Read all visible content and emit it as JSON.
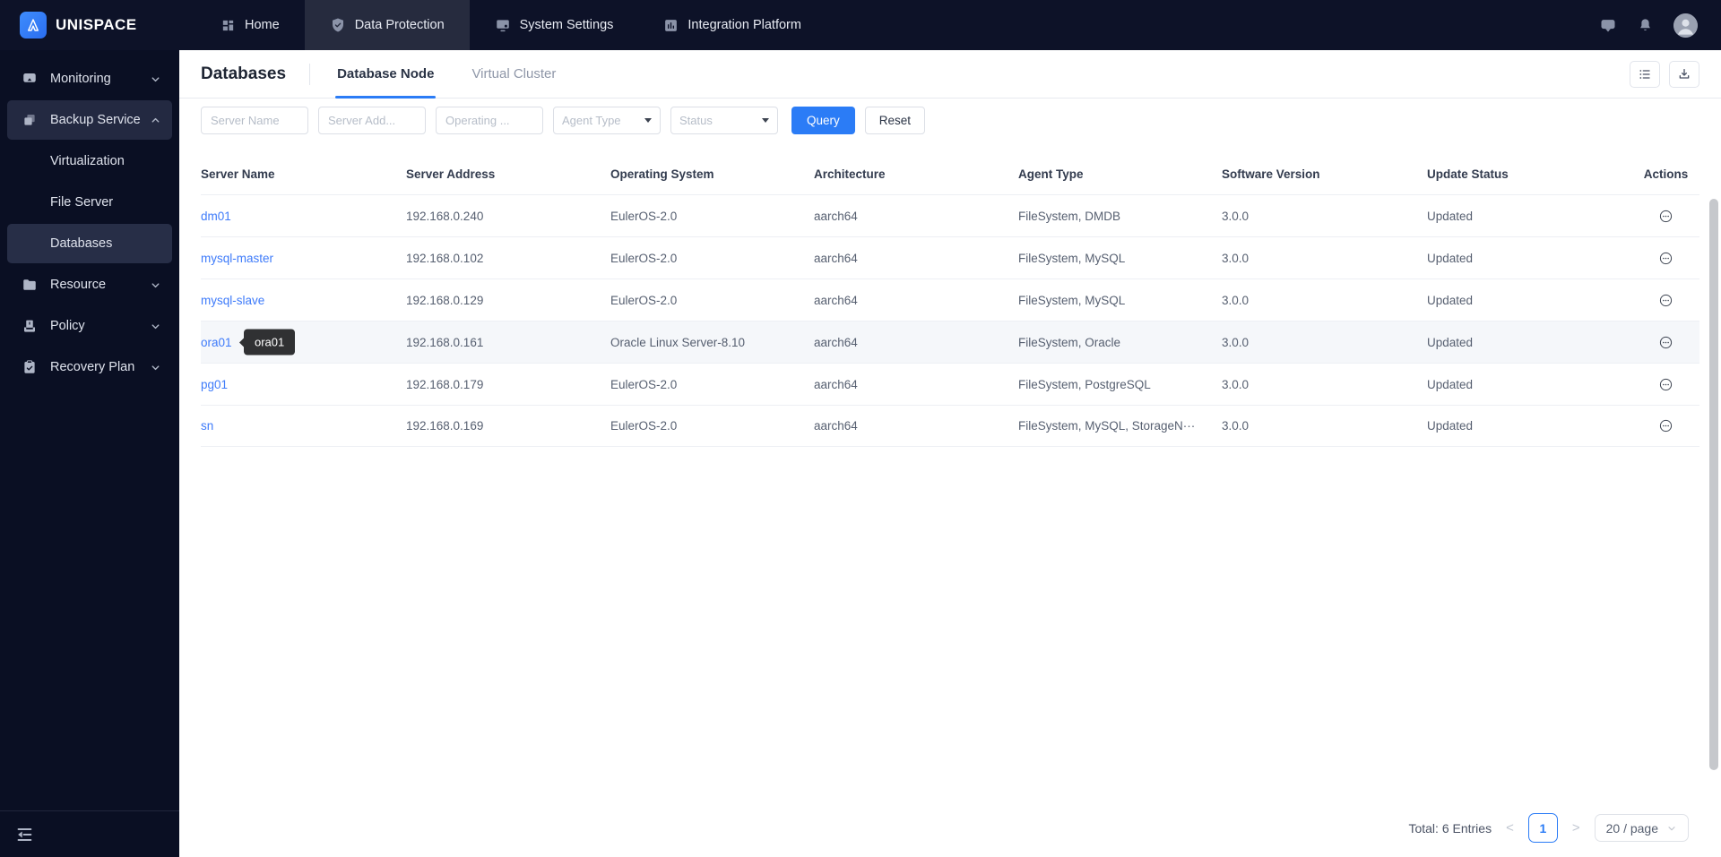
{
  "brand": {
    "name": "UNISPACE"
  },
  "topbar": {
    "nav": [
      {
        "label": "Home"
      },
      {
        "label": "Data Protection"
      },
      {
        "label": "System Settings"
      },
      {
        "label": "Integration Platform"
      }
    ]
  },
  "sidebar": {
    "items": [
      {
        "label": "Monitoring"
      },
      {
        "label": "Backup Service"
      },
      {
        "label": "Virtualization"
      },
      {
        "label": "File Server"
      },
      {
        "label": "Databases"
      },
      {
        "label": "Resource"
      },
      {
        "label": "Policy"
      },
      {
        "label": "Recovery Plan"
      }
    ]
  },
  "page": {
    "title": "Databases",
    "tabs": [
      {
        "label": "Database Node"
      },
      {
        "label": "Virtual Cluster"
      }
    ]
  },
  "filters": {
    "server_name_placeholder": "Server Name",
    "server_address_placeholder": "Server Add...",
    "operating_system_placeholder": "Operating ...",
    "agent_type_placeholder": "Agent Type",
    "status_placeholder": "Status",
    "query_label": "Query",
    "reset_label": "Reset"
  },
  "table": {
    "columns": [
      "Server Name",
      "Server Address",
      "Operating System",
      "Architecture",
      "Agent Type",
      "Software Version",
      "Update Status",
      "Actions"
    ],
    "rows": [
      {
        "name": "dm01",
        "address": "192.168.0.240",
        "os": "EulerOS-2.0",
        "arch": "aarch64",
        "agent": "FileSystem, DMDB",
        "version": "3.0.0",
        "status": "Updated"
      },
      {
        "name": "mysql-master",
        "address": "192.168.0.102",
        "os": "EulerOS-2.0",
        "arch": "aarch64",
        "agent": "FileSystem, MySQL",
        "version": "3.0.0",
        "status": "Updated"
      },
      {
        "name": "mysql-slave",
        "address": "192.168.0.129",
        "os": "EulerOS-2.0",
        "arch": "aarch64",
        "agent": "FileSystem, MySQL",
        "version": "3.0.0",
        "status": "Updated"
      },
      {
        "name": "ora01",
        "address": "192.168.0.161",
        "os": "Oracle Linux Server-8.10",
        "arch": "aarch64",
        "agent": "FileSystem, Oracle",
        "version": "3.0.0",
        "status": "Updated"
      },
      {
        "name": "pg01",
        "address": "192.168.0.179",
        "os": "EulerOS-2.0",
        "arch": "aarch64",
        "agent": "FileSystem, PostgreSQL",
        "version": "3.0.0",
        "status": "Updated"
      },
      {
        "name": "sn",
        "address": "192.168.0.169",
        "os": "EulerOS-2.0",
        "arch": "aarch64",
        "agent": "FileSystem, MySQL, StorageN···",
        "version": "3.0.0",
        "status": "Updated"
      }
    ]
  },
  "tooltip": {
    "text": "ora01"
  },
  "pagination": {
    "total_label": "Total: 6 Entries",
    "prev_label": "<",
    "current_page": "1",
    "next_label": ">",
    "page_size_label": "20 / page"
  },
  "colors": {
    "accent": "#2b7cf6",
    "link": "#3e7bfa",
    "topbar_bg": "#0d1228",
    "sidebar_bg": "#0a0f23",
    "tooltip_bg": "#303133",
    "row_hover": "#f5f7fa"
  }
}
